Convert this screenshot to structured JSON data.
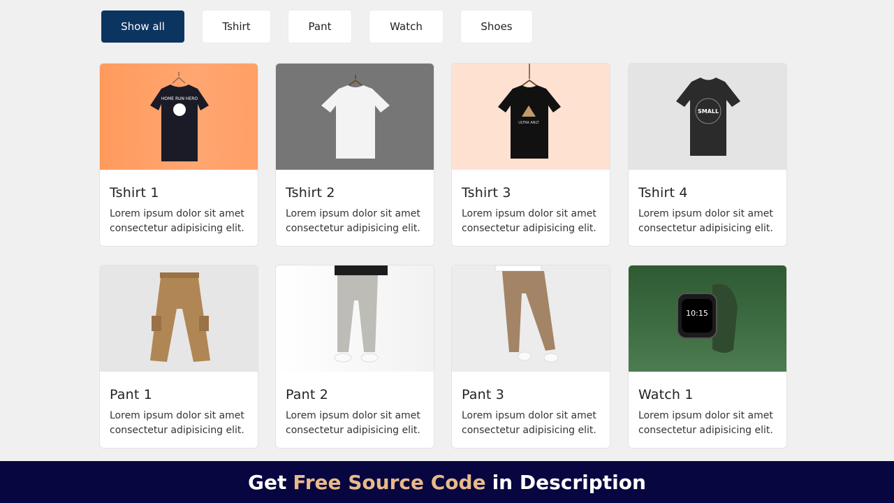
{
  "filters": [
    {
      "label": "Show all",
      "active": true
    },
    {
      "label": "Tshirt",
      "active": false
    },
    {
      "label": "Pant",
      "active": false
    },
    {
      "label": "Watch",
      "active": false
    },
    {
      "label": "Shoes",
      "active": false
    }
  ],
  "cards": [
    {
      "title": "Tshirt 1",
      "desc": "Lorem ipsum dolor sit amet consectetur adipisicing elit.",
      "image": "black-tshirt-home-run-hero",
      "image_text": "HOME RUN HERO"
    },
    {
      "title": "Tshirt 2",
      "desc": "Lorem ipsum dolor sit amet consectetur adipisicing elit.",
      "image": "white-tshirt"
    },
    {
      "title": "Tshirt 3",
      "desc": "Lorem ipsum dolor sit amet consectetur adipisicing elit.",
      "image": "black-tshirt-mountain",
      "image_text": "ULTRA ANLT"
    },
    {
      "title": "Tshirt 4",
      "desc": "Lorem ipsum dolor sit amet consectetur adipisicing elit.",
      "image": "dark-tshirt-small",
      "image_text": "SMALL"
    },
    {
      "title": "Pant 1",
      "desc": "Lorem ipsum dolor sit amet consectetur adipisicing elit.",
      "image": "khaki-cargo-pant"
    },
    {
      "title": "Pant 2",
      "desc": "Lorem ipsum dolor sit amet consectetur adipisicing elit.",
      "image": "grey-trousers"
    },
    {
      "title": "Pant 3",
      "desc": "Lorem ipsum dolor sit amet consectetur adipisicing elit.",
      "image": "brown-chinos"
    },
    {
      "title": "Watch 1",
      "desc": "Lorem ipsum dolor sit amet consectetur adipisicing elit.",
      "image": "green-smartwatch",
      "image_text": "10:15"
    }
  ],
  "banner": {
    "prefix": "Get",
    "accent": "Free Source Code",
    "suffix": "in Description"
  },
  "colors": {
    "active_filter": "#0c3461",
    "banner_bg": "#070640",
    "banner_accent": "#e9b98a"
  }
}
